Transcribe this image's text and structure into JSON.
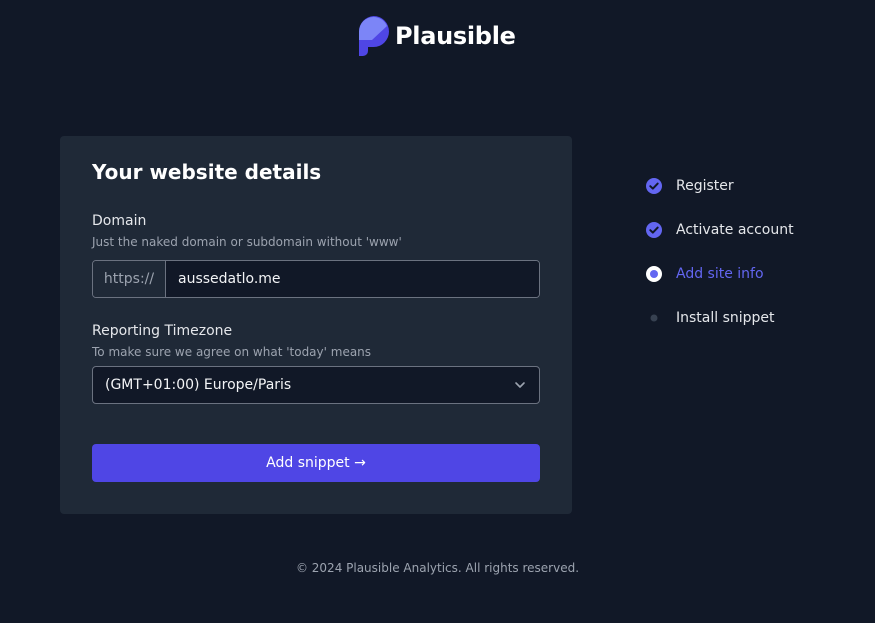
{
  "brand": {
    "name": "Plausible",
    "accent": "#6366f1",
    "button": "#4f46e5"
  },
  "form": {
    "title": "Your website details",
    "domain": {
      "label": "Domain",
      "help": "Just the naked domain or subdomain without 'www'",
      "prefix": "https://",
      "value": "aussedatlo.me"
    },
    "timezone": {
      "label": "Reporting Timezone",
      "help": "To make sure we agree on what 'today' means",
      "selected": "(GMT+01:00) Europe/Paris"
    },
    "submit_label": "Add snippet →"
  },
  "steps": [
    {
      "label": "Register",
      "state": "done"
    },
    {
      "label": "Activate account",
      "state": "done"
    },
    {
      "label": "Add site info",
      "state": "current"
    },
    {
      "label": "Install snippet",
      "state": "upcoming"
    }
  ],
  "footer": {
    "text": "© 2024 Plausible Analytics. All rights reserved."
  }
}
